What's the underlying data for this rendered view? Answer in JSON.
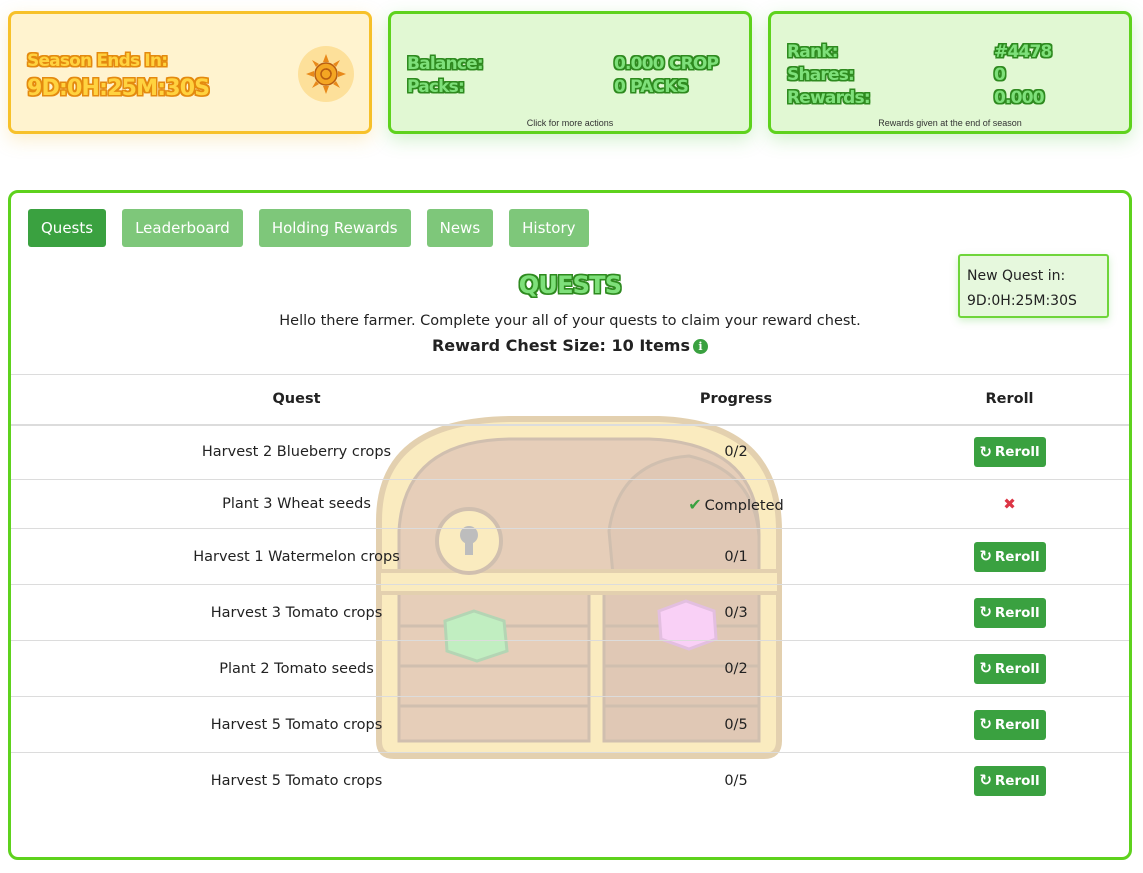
{
  "season": {
    "label": "Season Ends In:",
    "time": "9D:0H:25M:30S",
    "icon": "sun-icon"
  },
  "balance": {
    "balance_label": "Balance:",
    "balance_value": "0.000 CROP",
    "packs_label": "Packs:",
    "packs_value": "0 PACKS",
    "note": "Click for more actions"
  },
  "rank": {
    "rank_label": "Rank:",
    "rank_value": "#4478",
    "shares_label": "Shares:",
    "shares_value": "0",
    "rewards_label": "Rewards:",
    "rewards_value": "0.000",
    "note": "Rewards given at the end of season"
  },
  "tabs": [
    {
      "label": "Quests",
      "active": true
    },
    {
      "label": "Leaderboard"
    },
    {
      "label": "Holding Rewards"
    },
    {
      "label": "News"
    },
    {
      "label": "History"
    }
  ],
  "new_quest": {
    "label": "New Quest in:",
    "time": "9D:0H:25M:30S"
  },
  "quests": {
    "title": "QUESTS",
    "intro": "Hello there farmer. Complete your all of your quests to claim your reward chest.",
    "chest_size": "Reward Chest Size: 10 Items",
    "headers": {
      "quest": "Quest",
      "progress": "Progress",
      "reroll": "Reroll"
    },
    "reroll_label": "Reroll",
    "rows": [
      {
        "quest": "Harvest 2 Blueberry crops",
        "progress": "0/2"
      },
      {
        "quest": "Plant 3 Wheat seeds",
        "progress": "Completed"
      },
      {
        "quest": "Harvest 1 Watermelon crops",
        "progress": "0/1"
      },
      {
        "quest": "Harvest 3 Tomato crops",
        "progress": "0/3"
      },
      {
        "quest": "Plant 2 Tomato seeds",
        "progress": "0/2"
      },
      {
        "quest": "Harvest 5 Tomato crops",
        "progress": "0/5"
      },
      {
        "quest": "Harvest 5 Tomato crops",
        "progress": "0/5"
      }
    ]
  },
  "colors": {
    "accent_green": "#3aa140",
    "border_green": "#5ed21d",
    "season_yellow": "#f7c12a",
    "danger_red": "#dc3545"
  }
}
